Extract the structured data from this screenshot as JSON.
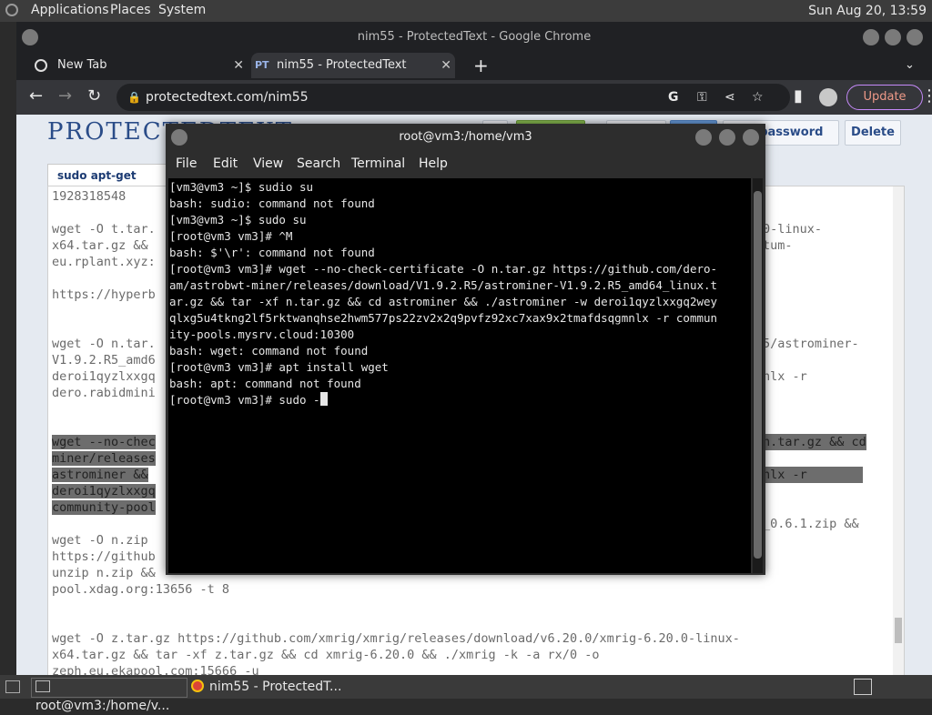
{
  "top_panel": {
    "applications": "Applications",
    "places": "Places",
    "system": "System",
    "clock": "Sun Aug 20, 13:59"
  },
  "chrome": {
    "window_title": "nim55 - ProtectedText - Google Chrome",
    "tabs": [
      {
        "label": "New Tab"
      },
      {
        "label": "nim55 - ProtectedText",
        "favicon": "PT"
      }
    ],
    "url": "protectedtext.com/nim55",
    "update_label": "Update"
  },
  "page": {
    "logo": "PROTECTEDTEXT",
    "change_password_label": "ge password",
    "delete_label": "Delete",
    "doc_tab_label": "sudo apt-get insta...",
    "doc_lines": [
      "1928318548",
      "",
      "wget -O t.tar.",
      "x64.tar.gz &&",
      "eu.rplant.xyz:",
      "",
      "https://hyperb",
      "",
      "",
      "wget -O n.tar.",
      "V1.9.2.R5_amd6",
      "deroi1qyzlxxgq",
      "dero.rabidmini",
      "",
      "",
      "wget --no-chec",
      "miner/releases",
      "astrominer &&",
      "deroi1qyzlxxgq",
      "community-pool",
      "",
      "wget -O n.zip",
      "https://github",
      "unzip n.zip &&",
      "pool.xdag.org:13656 -t 8",
      "",
      "",
      "wget -O z.tar.gz https://github.com/xmrig/xmrig/releases/download/v6.20.0/xmrig-6.20.0-linux-",
      "x64.tar.gz && tar -xf z.tar.gz && cd xmrig-6.20.0 && ./xmrig -k -a rx/0 -o",
      "zeph.eu.ekapool.com:15666 -u"
    ],
    "doc_right_fragments": [
      "0-linux-",
      "tum-",
      "5/astrominer-",
      "nlx -r",
      "n.tar.gz && cd",
      "nlx -r",
      "_0.6.1.zip &&"
    ]
  },
  "terminal": {
    "title": "root@vm3:/home/vm3",
    "menu": [
      "File",
      "Edit",
      "View",
      "Search",
      "Terminal",
      "Help"
    ],
    "lines": [
      "[vm3@vm3 ~]$ sudio su",
      "bash: sudio: command not found",
      "[vm3@vm3 ~]$ sudo su",
      "[root@vm3 vm3]# ^M",
      "bash: $'\\r': command not found",
      "[root@vm3 vm3]# wget --no-check-certificate -O n.tar.gz https://github.com/dero-",
      "am/astrobwt-miner/releases/download/V1.9.2.R5/astrominer-V1.9.2.R5_amd64_linux.t",
      "ar.gz && tar -xf n.tar.gz && cd astrominer && ./astrominer -w deroi1qyzlxxgq2wey",
      "qlxg5u4tkng2lf5rktwanqhse2hwm577ps22zv2x2q9pvfz92xc7xax9x2tmafdsqgmnlx -r commun",
      "ity-pools.mysrv.cloud:10300",
      "bash: wget: command not found",
      "[root@vm3 vm3]# apt install wget",
      "bash: apt: command not found"
    ],
    "prompt_line": "[root@vm3 vm3]# sudo -"
  },
  "taskbar": {
    "items": [
      {
        "label": "root@vm3:/home/v..."
      },
      {
        "label": "nim55 - ProtectedT..."
      }
    ]
  }
}
